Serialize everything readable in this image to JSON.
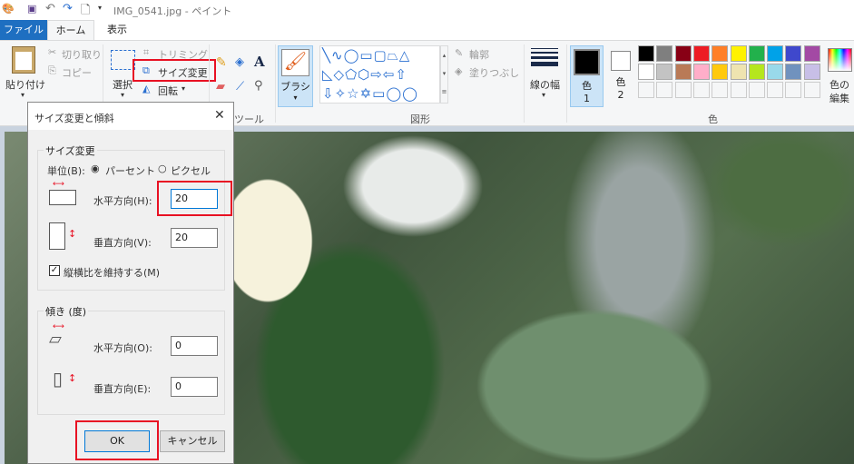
{
  "window": {
    "title": "IMG_0541.jpg - ペイント"
  },
  "tabs": [
    {
      "label": "ファイル"
    },
    {
      "label": "ホーム"
    },
    {
      "label": "表示"
    }
  ],
  "clipboard": {
    "paste": "貼り付け",
    "cut": "切り取り",
    "copy": "コピー"
  },
  "image": {
    "select": "選択",
    "crop": "トリミング",
    "resize": "サイズ変更",
    "rotate": "回転"
  },
  "tools": {
    "label": "ツール"
  },
  "brush": {
    "label": "ブラシ"
  },
  "shapes": {
    "label": "図形",
    "outline": "輪郭",
    "fill": "塗りつぶし"
  },
  "line_width": {
    "label": "線の幅"
  },
  "colors": {
    "label": "色",
    "color1": "色",
    "color1_num": "1",
    "color2": "色",
    "color2_num": "2",
    "edit": "色の",
    "edit2": "編集",
    "palette": [
      "#000000",
      "#7f7f7f",
      "#880015",
      "#ed1c24",
      "#ff7f27",
      "#fff200",
      "#22b14c",
      "#00a2e8",
      "#3f48cc",
      "#a349a4",
      "#ffffff",
      "#c3c3c3",
      "#b97a57",
      "#ffaec9",
      "#ffc90e",
      "#efe4b0",
      "#b5e61d",
      "#99d9ea",
      "#7092be",
      "#c8bfe7"
    ]
  },
  "dialog": {
    "title": "サイズ変更と傾斜",
    "resize_group": "サイズ変更",
    "unit_label": "単位(B):",
    "percent": "パーセント",
    "pixel": "ピクセル",
    "horizontal_label": "水平方向(H):",
    "horizontal_value": "20",
    "vertical_label": "垂直方向(V):",
    "vertical_value": "20",
    "keep_ratio": "縦横比を維持する(M)",
    "skew_group": "傾き (度)",
    "skew_h_label": "水平方向(O):",
    "skew_h_value": "0",
    "skew_v_label": "垂直方向(E):",
    "skew_v_value": "0",
    "ok": "OK",
    "cancel": "キャンセル"
  }
}
